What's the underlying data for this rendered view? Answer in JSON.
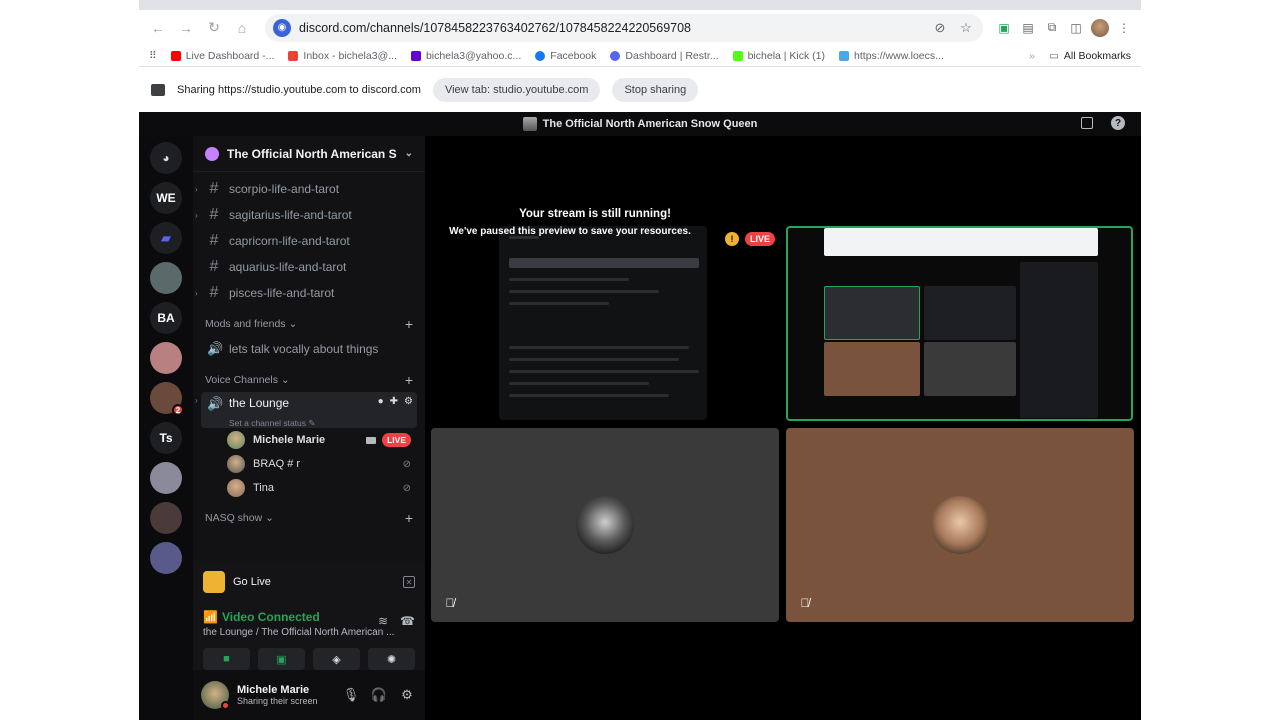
{
  "browser": {
    "url": "discord.com/channels/1078458223763402762/1078458224220569708",
    "bookmarks": [
      {
        "label": "Live Dashboard -...",
        "color": "#ff0000"
      },
      {
        "label": "Inbox - bichela3@...",
        "color": "#ea4335"
      },
      {
        "label": "bichela3@yahoo.c...",
        "color": "#6001d2"
      },
      {
        "label": "Facebook",
        "color": "#1877f2"
      },
      {
        "label": "Dashboard | Restr...",
        "color": "#5865f2"
      },
      {
        "label": "bichela | Kick (1)",
        "color": "#53fc18"
      },
      {
        "label": "https://www.loecs...",
        "color": "#4aa8e8"
      }
    ],
    "bookmarks_more": "»",
    "all_bookmarks": "All Bookmarks",
    "share": {
      "text": "Sharing https://studio.youtube.com to discord.com",
      "view_tab": "View tab: studio.youtube.com",
      "stop": "Stop sharing"
    }
  },
  "discord": {
    "title": "The Official North American Snow Queen",
    "guilds": [
      {
        "label": "",
        "color": "#1e1f22",
        "icon": "discord-logo-icon"
      },
      {
        "label": "WE",
        "color": "#1e1f22"
      },
      {
        "label": "",
        "color": "#1e1f22",
        "icon": "folder-icon"
      },
      {
        "label": "",
        "color": "#5a6a6a"
      },
      {
        "label": "BA",
        "color": "#1e1f22"
      },
      {
        "label": "",
        "color": "#b88080"
      },
      {
        "label": "",
        "color": "#6a4a3a",
        "badge": "2"
      },
      {
        "label": "Ts",
        "color": "#1e1f22"
      },
      {
        "label": "",
        "color": "#8a8a9a"
      },
      {
        "label": "",
        "color": "#4a3a3a"
      },
      {
        "label": "",
        "color": "#5a5a8a"
      }
    ],
    "server_name": "The Official North American S...",
    "text_channels": [
      {
        "name": "scorpio-life-and-tarot",
        "expand": true
      },
      {
        "name": "sagitarius-life-and-tarot",
        "expand": true
      },
      {
        "name": "capricorn-life-and-tarot",
        "expand": false
      },
      {
        "name": "aquarius-life-and-tarot",
        "expand": false
      },
      {
        "name": "pisces-life-and-tarot",
        "expand": true
      }
    ],
    "cat_mods": "Mods and friends",
    "mods_channel": "lets talk vocally about things",
    "cat_voice": "Voice Channels",
    "lounge": "the Lounge",
    "lounge_status": "Set a channel status",
    "members": [
      {
        "name": "Michele Marie",
        "live": "LIVE",
        "color": "#5a8a5a"
      },
      {
        "name": "BRAQ # r",
        "live": "",
        "color": "#555"
      },
      {
        "name": "Tina",
        "live": "",
        "color": "#8a6a5a"
      }
    ],
    "cat_nasq": "NASQ show",
    "go_live": "Go Live",
    "voice": {
      "status": "Video Connected",
      "channel": "the Lounge / The Official North American ..."
    },
    "user": {
      "name": "Michele Marie",
      "sub": "Sharing their screen"
    },
    "stream": {
      "paused_title": "Your stream is still running!",
      "paused_sub": "We've paused this preview to save your resources.",
      "live": "LIVE",
      "warn": "!"
    }
  }
}
